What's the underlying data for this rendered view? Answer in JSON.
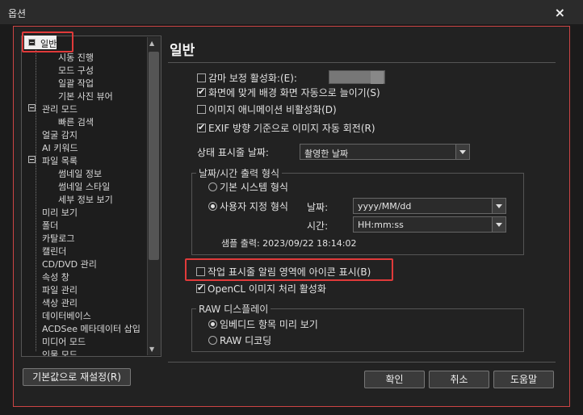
{
  "window": {
    "title": "옵션",
    "close_symbol": "×"
  },
  "tree": {
    "items": [
      {
        "label": "일반"
      },
      {
        "label": "시동 진행"
      },
      {
        "label": "모드 구성"
      },
      {
        "label": "일괄 작업"
      },
      {
        "label": "기본 사진 뷰어"
      },
      {
        "label": "관리 모드"
      },
      {
        "label": "빠른 검색"
      },
      {
        "label": "얼굴 감지"
      },
      {
        "label": "AI 키워드"
      },
      {
        "label": "파일 목록"
      },
      {
        "label": "썸네일 정보"
      },
      {
        "label": "썸네일 스타일"
      },
      {
        "label": "세부 정보 보기"
      },
      {
        "label": "미리 보기"
      },
      {
        "label": "폴더"
      },
      {
        "label": "카탈로그"
      },
      {
        "label": "캘린더"
      },
      {
        "label": "CD/DVD 관리"
      },
      {
        "label": "속성 창"
      },
      {
        "label": "파일 관리"
      },
      {
        "label": "색상 관리"
      },
      {
        "label": "데이터베이스"
      },
      {
        "label": "ACDSee 메타데이터 삽입"
      },
      {
        "label": "미디어 모드"
      },
      {
        "label": "인물 모드"
      }
    ]
  },
  "page": {
    "title": "일반"
  },
  "options": {
    "gamma": "감마 보정 활성화:(E):",
    "fit_bg": "화면에 맞게 배경 화면 자동으로 늘이기(S)",
    "disable_anim": "이미지 애니메이션 비활성화(D)",
    "exif_rotate": "EXIF 방향 기준으로 이미지 자동 회전(R)",
    "statusbar_date_label": "상태 표시줄 날짜:",
    "statusbar_date_value": "촬영한 날짜",
    "tray_icon": "작업 표시줄 알림 영역에 아이콘 표시(B)",
    "opencl": "OpenCL 이미지 처리 활성화"
  },
  "datetime_group": {
    "title": "날짜/시간 출력 형식",
    "system_format": "기본 시스템 형식",
    "custom_format": "사용자 지정 형식",
    "date_label": "날짜:",
    "date_value": "yyyy/MM/dd",
    "time_label": "시간:",
    "time_value": "HH:mm:ss",
    "sample": "샘플 출력: 2023/09/22 18:14:02"
  },
  "raw_group": {
    "title": "RAW 디스플레이",
    "embedded": "임베디드 항목 미리 보기",
    "decode": "RAW 디코딩"
  },
  "buttons": {
    "reset": "기본값으로 재설정(R)",
    "ok": "확인",
    "cancel": "취소",
    "help": "도움말"
  }
}
